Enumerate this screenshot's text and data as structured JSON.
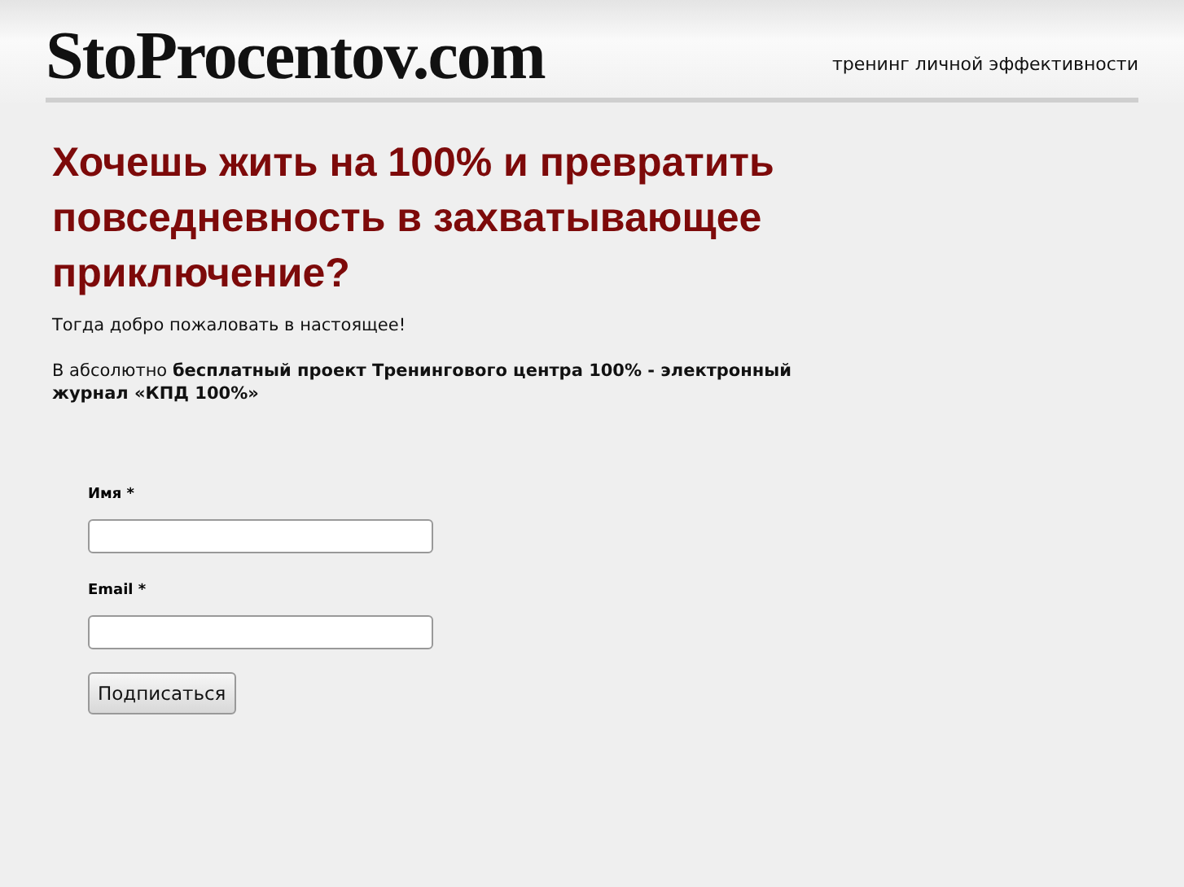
{
  "header": {
    "logo": "StoProcentov.com",
    "tagline": "тренинг личной эффективности"
  },
  "headline": "Хочешь жить на 100% и превратить повседневность в захватывающее приключение?",
  "paragraphs": [
    "Тогда добро пожаловать в настоящее!",
    "В абсолютно **бесплатный проект Тренингового центра 100% - электронный журнал «КПД 100%»**"
  ],
  "form": {
    "fields": [
      {
        "label": "Имя *"
      },
      {
        "label": "Email *"
      }
    ],
    "submit": "Подписаться"
  }
}
